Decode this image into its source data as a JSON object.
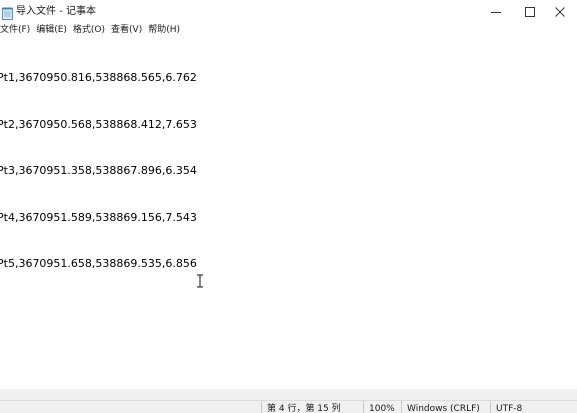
{
  "window": {
    "title": "导入文件 - 记事本",
    "app_icon": "notepad-icon",
    "controls": {
      "minimize_icon": "minimize-icon",
      "maximize_icon": "maximize-icon",
      "close_icon": "close-icon"
    }
  },
  "menu": {
    "items": [
      {
        "label": "文件(F)"
      },
      {
        "label": "编辑(E)"
      },
      {
        "label": "格式(O)"
      },
      {
        "label": "查看(V)"
      },
      {
        "label": "帮助(H)"
      }
    ]
  },
  "editor": {
    "lines": [
      "Pt1,3670950.816,538868.565,6.762",
      "Pt2,3670950.568,538868.412,7.653",
      "Pt3,3670951.358,538867.896,6.354",
      "Pt4,3670951.589,538869.156,7.543",
      "Pt5,3670951.658,538869.535,6.856"
    ],
    "cursor_icon": "text-cursor-icon"
  },
  "status": {
    "position": "第 4 行，第 15 列",
    "zoom": "100%",
    "line_ending": "Windows (CRLF)",
    "encoding": "UTF-8"
  }
}
